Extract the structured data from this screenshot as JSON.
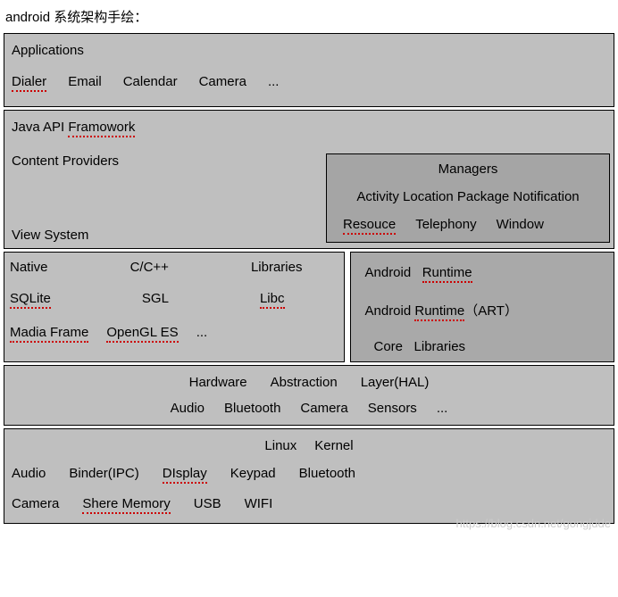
{
  "title": "android 系统架构手绘：",
  "applications": {
    "title": "Applications",
    "items": [
      "Dialer",
      "Email",
      "Calendar",
      "Camera",
      "..."
    ]
  },
  "framework": {
    "title": "Java API Framowork",
    "left_top": "Content Providers",
    "left_bottom": "View System",
    "managers": {
      "title": "Managers",
      "row1": "Activity Location Package Notification",
      "row2": [
        "Resouce",
        "Telephony",
        "Window"
      ]
    }
  },
  "native": {
    "title_parts": [
      "Native",
      "C/C++",
      "Libraries"
    ],
    "row1": [
      "SQLite",
      "SGL",
      "Libc"
    ],
    "row2": [
      "Madia Frame",
      "OpenGL ES",
      "..."
    ]
  },
  "runtime": {
    "title_parts": [
      "Android",
      "Runtime"
    ],
    "row1": "Android Runtime（ART）",
    "row2_parts": [
      "Core",
      "Libraries"
    ]
  },
  "hal": {
    "title_parts": [
      "Hardware",
      "Abstraction",
      "Layer(HAL)"
    ],
    "items": [
      "Audio",
      "Bluetooth",
      "Camera",
      "Sensors",
      "..."
    ]
  },
  "kernel": {
    "title_parts": [
      "Linux",
      "Kernel"
    ],
    "row1": [
      "Audio",
      "Binder(IPC)",
      "DIsplay",
      "Keypad",
      "Bluetooth"
    ],
    "row2": [
      "Camera",
      "Shere Memory",
      "USB",
      "WIFI"
    ]
  },
  "watermark": "https://blog.csdn.net/gongjdde"
}
